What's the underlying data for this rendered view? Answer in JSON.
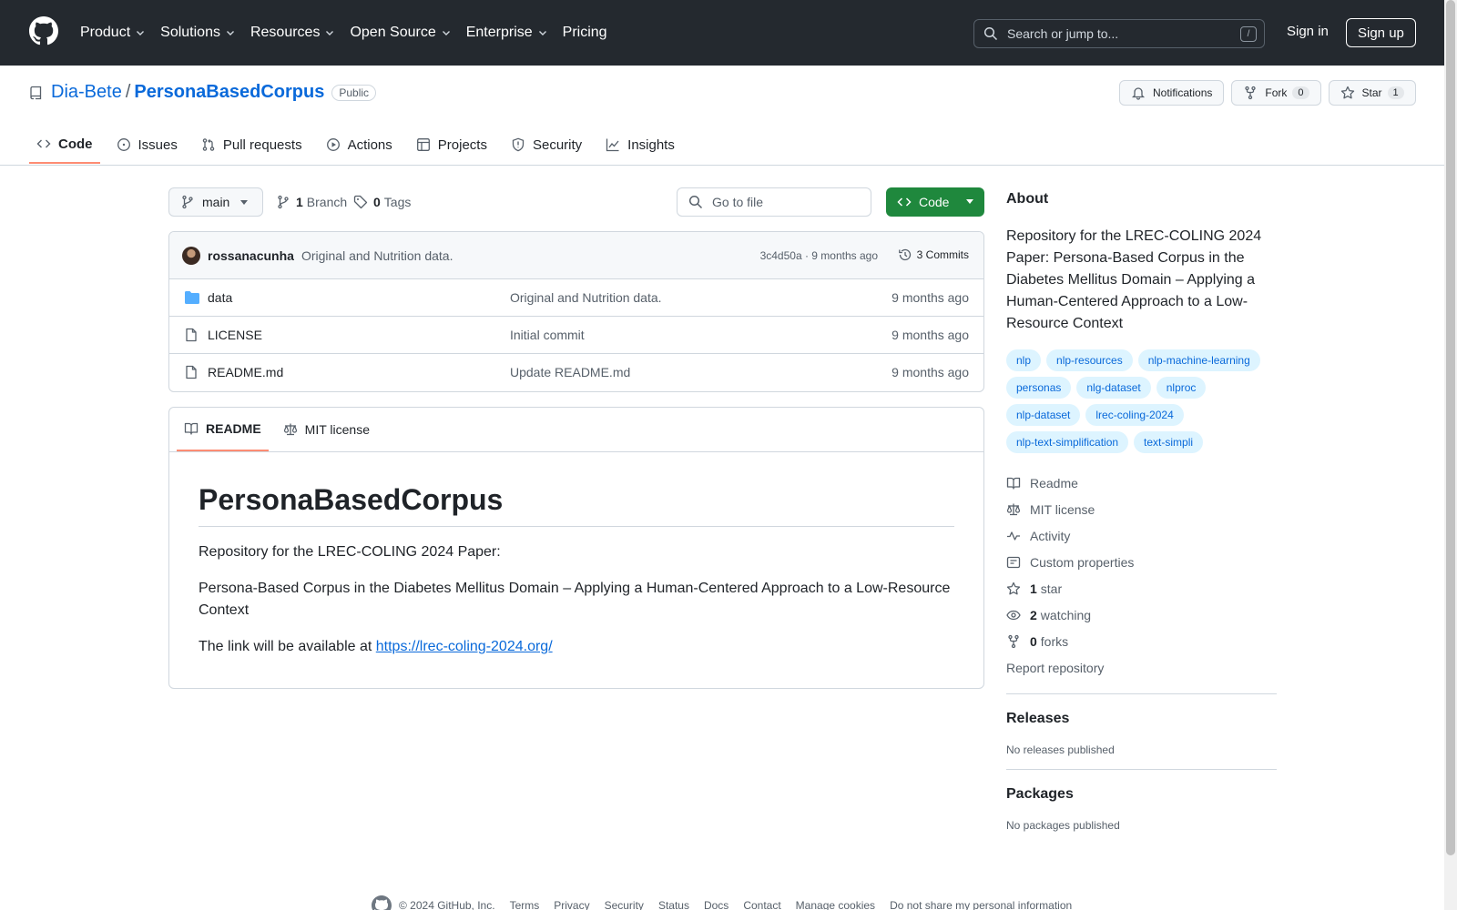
{
  "header": {
    "nav": [
      {
        "label": "Product"
      },
      {
        "label": "Solutions"
      },
      {
        "label": "Resources"
      },
      {
        "label": "Open Source"
      },
      {
        "label": "Enterprise"
      },
      {
        "label": "Pricing"
      }
    ],
    "search_placeholder": "Search or jump to...",
    "search_shortcut": "/",
    "signin": "Sign in",
    "signup": "Sign up"
  },
  "repo": {
    "owner": "Dia-Bete",
    "separator": "/",
    "name": "PersonaBasedCorpus",
    "visibility": "Public",
    "notifications": "Notifications",
    "fork_label": "Fork",
    "fork_count": "0",
    "star_label": "Star",
    "star_count": "1"
  },
  "tabs": [
    {
      "label": "Code"
    },
    {
      "label": "Issues"
    },
    {
      "label": "Pull requests"
    },
    {
      "label": "Actions"
    },
    {
      "label": "Projects"
    },
    {
      "label": "Security"
    },
    {
      "label": "Insights"
    }
  ],
  "toolbar": {
    "branch": "main",
    "branch_count": "1",
    "branch_label": "Branch",
    "tag_count": "0",
    "tag_label": "Tags",
    "goto_placeholder": "Go to file",
    "code_label": "Code"
  },
  "commit": {
    "author": "rossanacunha",
    "message": "Original and Nutrition data.",
    "meta": "3c4d50a · 9 months ago",
    "commits": "3 Commits"
  },
  "files": [
    {
      "name": "data",
      "type": "folder",
      "message": "Original and Nutrition data.",
      "date": "9 months ago"
    },
    {
      "name": "LICENSE",
      "type": "file",
      "message": "Initial commit",
      "date": "9 months ago"
    },
    {
      "name": "README.md",
      "type": "file",
      "message": "Update README.md",
      "date": "9 months ago"
    }
  ],
  "readme": {
    "tab_readme": "README",
    "tab_license": "MIT license",
    "title": "PersonaBasedCorpus",
    "p1": "Repository for the LREC-COLING 2024 Paper:",
    "p2": "Persona-Based Corpus in the Diabetes Mellitus Domain – Applying a Human-Centered Approach to a Low-Resource Context",
    "p3_prefix": "The link will be available at ",
    "p3_link": "https://lrec-coling-2024.org/"
  },
  "about": {
    "title": "About",
    "description": "Repository for the LREC-COLING 2024 Paper: Persona-Based Corpus in the Diabetes Mellitus Domain – Applying a Human-Centered Approach to a Low-Resource Context",
    "topics": [
      "nlp",
      "nlp-resources",
      "nlp-machine-learning",
      "personas",
      "nlg-dataset",
      "nlproc",
      "nlp-dataset",
      "lrec-coling-2024",
      "nlp-text-simplification",
      "text-simpli"
    ],
    "readme": "Readme",
    "license": "MIT license",
    "activity": "Activity",
    "custom_properties": "Custom properties",
    "stars_count": "1",
    "stars_label": "star",
    "watching_count": "2",
    "watching_label": "watching",
    "forks_count": "0",
    "forks_label": "forks",
    "report": "Report repository"
  },
  "releases": {
    "title": "Releases",
    "empty": "No releases published"
  },
  "packages": {
    "title": "Packages",
    "empty": "No packages published"
  },
  "footer": {
    "copyright": "© 2024 GitHub, Inc.",
    "links": [
      "Terms",
      "Privacy",
      "Security",
      "Status",
      "Docs",
      "Contact",
      "Manage cookies",
      "Do not share my personal information"
    ]
  },
  "colors": {
    "header_bg": "#24292f",
    "link": "#0969da",
    "primary_button": "#1f883d",
    "tab_underline": "#fd8c73",
    "topic_bg": "#ddf4ff"
  }
}
